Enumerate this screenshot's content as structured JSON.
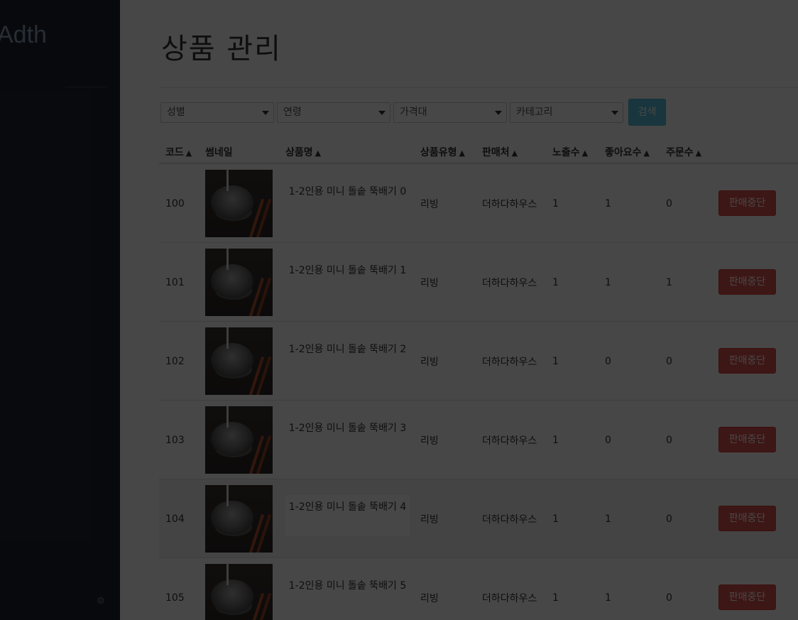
{
  "sidebar": {
    "brand": "Adth"
  },
  "page": {
    "title": "상품 관리"
  },
  "filters": {
    "gender": "성별",
    "age": "연령",
    "price": "가격대",
    "category": "카테고리",
    "search_label": "검색"
  },
  "table": {
    "headers": {
      "code": "코드",
      "thumbnail": "썸네일",
      "name": "상품명",
      "type": "상품유형",
      "seller": "판매처",
      "views": "노출수",
      "likes": "좋아요수",
      "orders": "주문수"
    },
    "rows": [
      {
        "code": "100",
        "name": "1-2인용 미니 돌솥 뚝배기 0",
        "type": "리빙",
        "seller": "더하다하우스",
        "views": "1",
        "likes": "1",
        "orders": "0",
        "action": "판매중단"
      },
      {
        "code": "101",
        "name": "1-2인용 미니 돌솥 뚝배기 1",
        "type": "리빙",
        "seller": "더하다하우스",
        "views": "1",
        "likes": "1",
        "orders": "1",
        "action": "판매중단"
      },
      {
        "code": "102",
        "name": "1-2인용 미니 돌솥 뚝배기 2",
        "type": "리빙",
        "seller": "더하다하우스",
        "views": "1",
        "likes": "0",
        "orders": "0",
        "action": "판매중단"
      },
      {
        "code": "103",
        "name": "1-2인용 미니 돌솥 뚝배기 3",
        "type": "리빙",
        "seller": "더하다하우스",
        "views": "1",
        "likes": "0",
        "orders": "0",
        "action": "판매중단"
      },
      {
        "code": "104",
        "name": "1-2인용 미니 돌솥 뚝배기 4",
        "type": "리빙",
        "seller": "더하다하우스",
        "views": "1",
        "likes": "1",
        "orders": "0",
        "action": "판매중단"
      },
      {
        "code": "105",
        "name": "1-2인용 미니 돌솥 뚝배기 5",
        "type": "리빙",
        "seller": "더하다하우스",
        "views": "1",
        "likes": "1",
        "orders": "0",
        "action": "판매중단"
      }
    ]
  },
  "colors": {
    "stop_button": "#d9534f",
    "search_button": "#5bc0de",
    "sidebar": "#1b2330",
    "overlay": "rgba(0,0,0,0.72)"
  }
}
